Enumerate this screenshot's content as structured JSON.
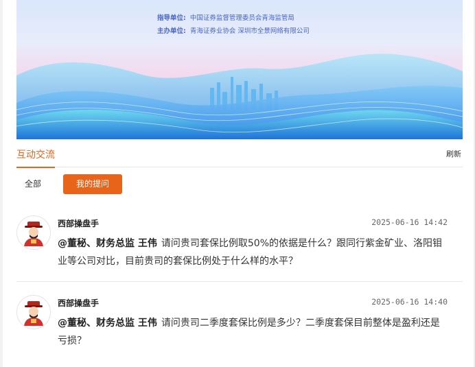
{
  "banner": {
    "line1_label": "指导单位:",
    "line1_text": "中国证券监督管理委员会青海监管局",
    "line2_label": "主办单位:",
    "line2_text": "青海证券业协会  深圳市全景网络有限公司"
  },
  "tabs": {
    "active_label": "互动交流",
    "refresh_label": "刷新"
  },
  "subtabs": {
    "all_label": "全部",
    "mine_label": "我的提问"
  },
  "questions": [
    {
      "author": "西部操盘手",
      "time": "2025-06-16 14:42",
      "mention": "@董秘、财务总监 王伟",
      "text": "请问贵司套保比例取50%的依据是什么？跟同行紫金矿业、洛阳钼业等公司对比，目前贵司的套保比例处于什么样的水平？"
    },
    {
      "author": "西部操盘手",
      "time": "2025-06-16 14:40",
      "mention": "@董秘、财务总监 王伟",
      "text": "请问贵司二季度套保比例是多少？二季度套保目前整体是盈利还是亏损？"
    }
  ],
  "colors": {
    "accent": "#e8641b",
    "banner_text": "#4a67c7"
  }
}
